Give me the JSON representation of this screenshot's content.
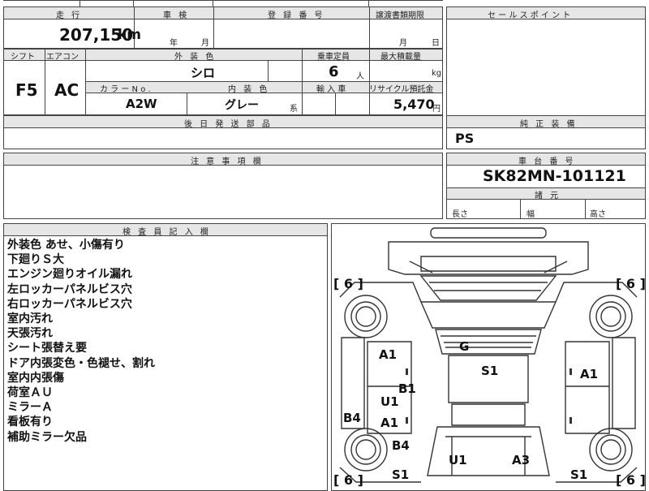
{
  "header": {
    "mileage_label": "走 行",
    "mileage_value": "207,150",
    "mileage_unit": "km",
    "inspection_label": "車 検",
    "inspection_year": "年",
    "inspection_month": "月",
    "registration_label": "登 録 番 号",
    "transfer_doc_label": "譲渡書類期限",
    "transfer_month": "月",
    "transfer_day": "日",
    "sales_point_label": "セ ー ル ス ポ イ ン ト"
  },
  "specs": {
    "shift_label": "シフト",
    "shift_value": "F5",
    "aircon_label": "エアコン",
    "aircon_value": "AC",
    "exterior_color_label": "外 装 色",
    "exterior_color_value": "シロ",
    "capacity_label": "乗車定員",
    "capacity_value": "6",
    "capacity_unit": "人",
    "max_load_label": "最大積載量",
    "max_load_unit": "kg",
    "color_no_label": "カ ラ ー N o .",
    "color_no_value": "A2W",
    "interior_color_label": "内 装 色",
    "interior_color_value": "グレー",
    "interior_color_suffix": "系",
    "import_label": "輸 入 車",
    "recycle_label": "リサイクル預託金",
    "recycle_value": "5,470",
    "recycle_unit": "円",
    "later_parts_label": "後 日 発 送 部 品",
    "genuine_equipment_label": "純 正 装 備",
    "genuine_equipment_value": "PS"
  },
  "caution": {
    "label": "注 意 事 項 欄"
  },
  "chassis": {
    "label": "車 台 番 号",
    "value": "SK82MN-101121",
    "dimensions_label": "諸 元",
    "length_label": "長さ",
    "width_label": "幅",
    "height_label": "高さ"
  },
  "inspector": {
    "label": "検 査 員 記 入 欄",
    "notes": [
      "外装色 あせ、小傷有り",
      "下廻りＳ大",
      "エンジン廻りオイル漏れ",
      "左ロッカーパネルビス穴",
      "右ロッカーパネルビス穴",
      "室内汚れ",
      "天張汚れ",
      "シート張替え要",
      "ドア内張変色・色褪せ、割れ",
      "室内内張傷",
      "荷室ＡＵ",
      "ミラーＡ",
      "看板有り",
      "補助ミラー欠品"
    ]
  },
  "diagram": {
    "tire_counts": [
      "[ 6 ]",
      "[ 6 ]",
      "[ 6 ]",
      "[ 6 ]"
    ],
    "marks": [
      "G",
      "A1",
      "S1",
      "A1",
      "B1",
      "U1",
      "B4",
      "A1",
      "B4",
      "U1",
      "A3",
      "S1",
      "S1"
    ]
  }
}
